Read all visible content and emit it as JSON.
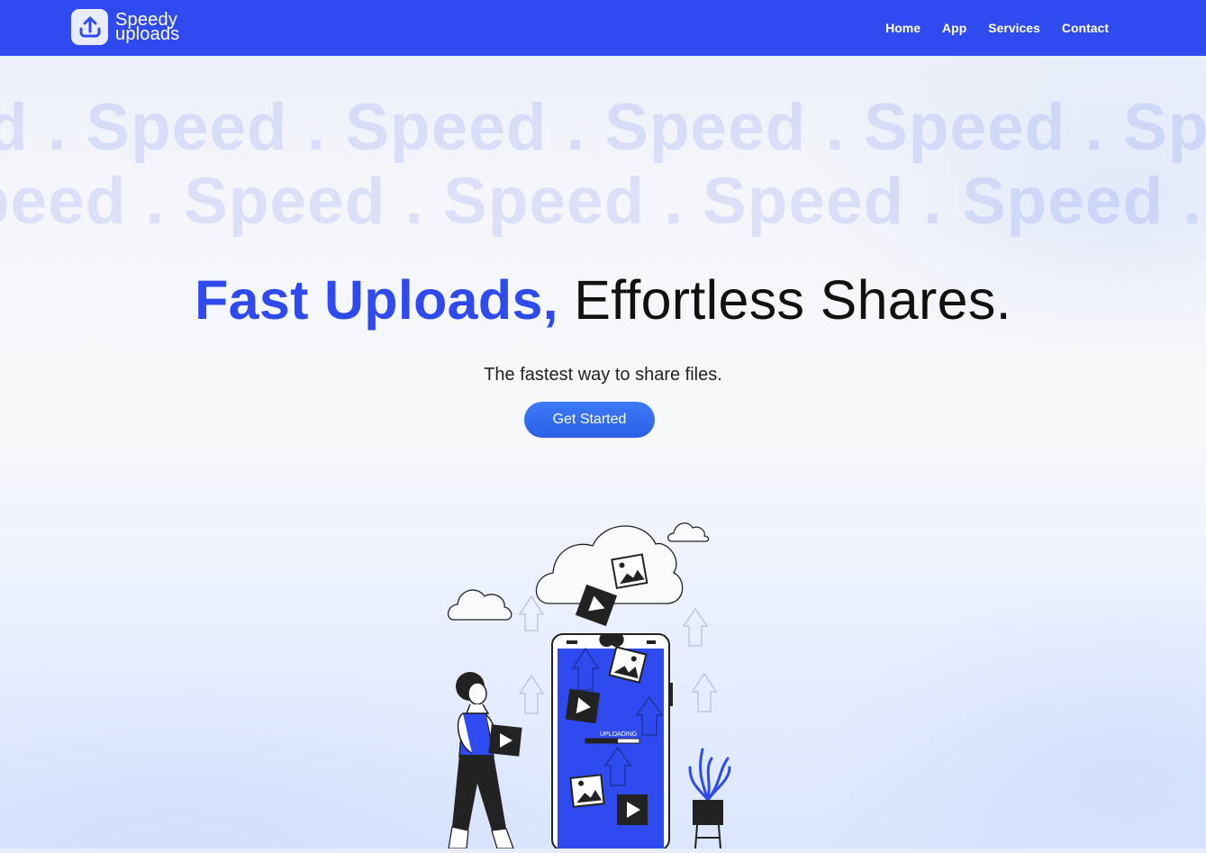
{
  "brand": {
    "name_line1": "Speedy",
    "name_line2": "uploads",
    "color": "#2f4bef",
    "logo_icon": "upload-arrow-icon"
  },
  "nav": {
    "items": [
      {
        "label": "Home"
      },
      {
        "label": "App"
      },
      {
        "label": "Services"
      },
      {
        "label": "Contact"
      }
    ]
  },
  "hero": {
    "background_word": "Speed",
    "separator": " . ",
    "headline_accent": "Fast Uploads,",
    "headline_rest": "Effortless Shares.",
    "subtitle": "The fastest way to share files.",
    "cta_label": "Get Started",
    "illustration": {
      "icon": "phone-upload-illustration",
      "phone_status": "UPLOADING",
      "accent_color": "#2f4bef"
    }
  }
}
